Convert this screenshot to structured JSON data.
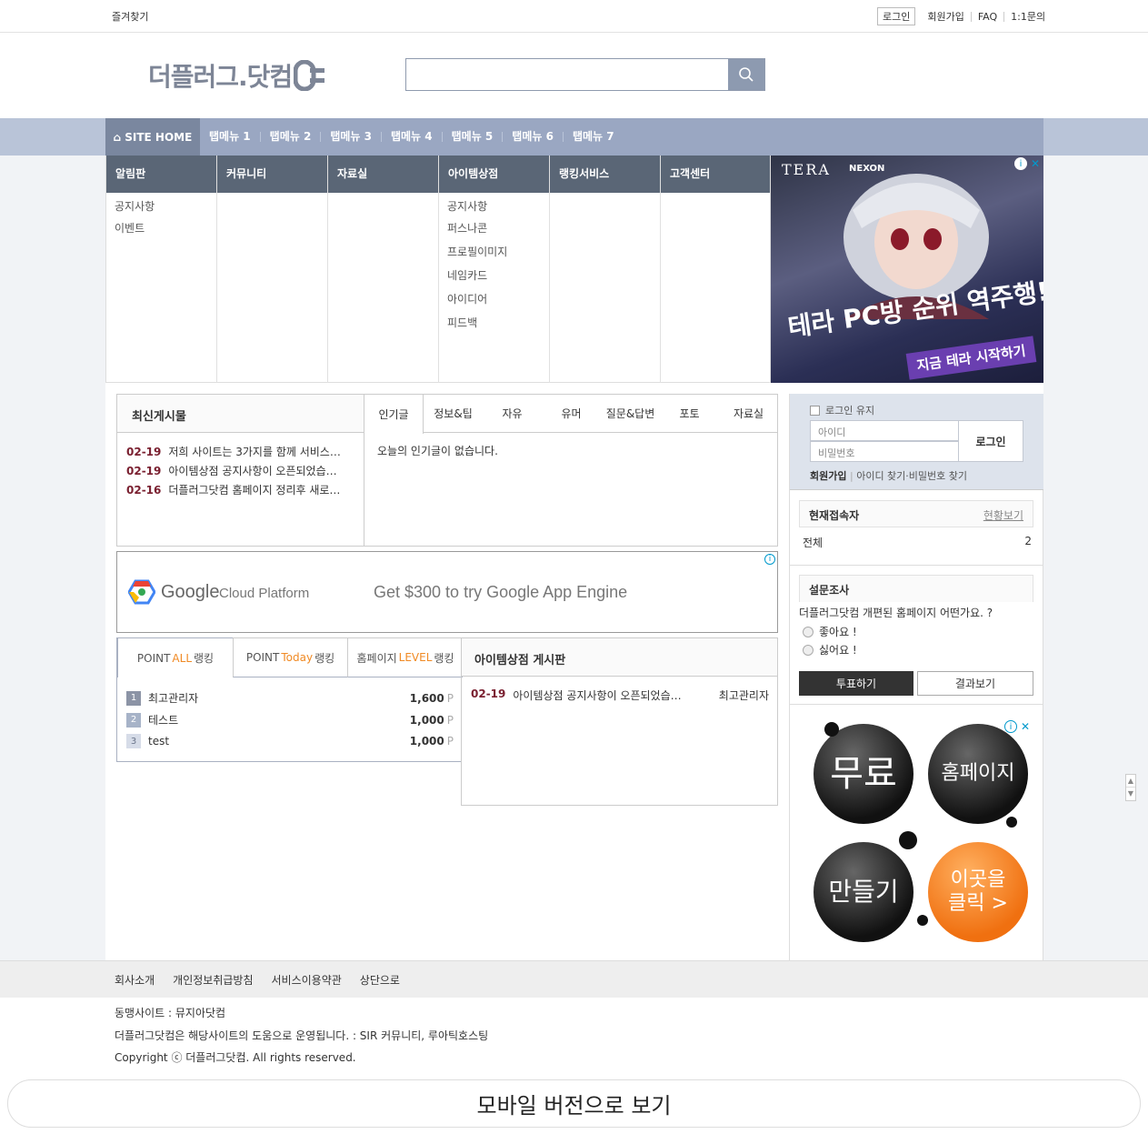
{
  "topbar": {
    "bookmark": "즐겨찾기",
    "login": "로그인",
    "links": [
      "회원가입",
      "FAQ",
      "1:1문의"
    ]
  },
  "header": {
    "logo_text": "더플러그.닷컴",
    "search_placeholder": ""
  },
  "nav": {
    "home": "SITE HOME",
    "tabs": [
      "탭메뉴 1",
      "탭메뉴 2",
      "탭메뉴 3",
      "탭메뉴 4",
      "탭메뉴 5",
      "탭메뉴 6",
      "탭메뉴 7"
    ]
  },
  "megamenu": [
    {
      "title": "알림판",
      "items": [
        "공지사항",
        "이벤트"
      ]
    },
    {
      "title": "커뮤니티",
      "items": []
    },
    {
      "title": "자료실",
      "items": []
    },
    {
      "title": "아이템상점",
      "items": [
        "공지사항",
        "퍼스나콘",
        "프로필이미지",
        "네임카드",
        "아이디어",
        "피드백"
      ]
    },
    {
      "title": "랭킹서비스",
      "items": []
    },
    {
      "title": "고객센터",
      "items": []
    }
  ],
  "ad1": {
    "brand1": "TERA",
    "brand2": "NEXON",
    "headline": "테라 PC방 순위 역주행!",
    "cta": "지금 테라 시작하기"
  },
  "latest": {
    "title": "최신게시물",
    "posts": [
      {
        "date": "02-19",
        "text": "저희 사이트는 3가지를 함께 서비스…"
      },
      {
        "date": "02-19",
        "text": "아이템상점 공지사항이 오픈되었습…"
      },
      {
        "date": "02-16",
        "text": "더플러그닷컴 홈페이지 정리후 새로…"
      }
    ],
    "tabs": [
      "인기글",
      "정보&팁",
      "자유",
      "유머",
      "질문&답변",
      "포토",
      "자료실"
    ],
    "empty": "오늘의 인기글이 없습니다."
  },
  "ad2": {
    "brand": "Google",
    "product": "Cloud Platform",
    "text": "Get $300 to try Google App Engine"
  },
  "ranking": {
    "tabs": [
      {
        "pre": "POINT ",
        "hl": "ALL",
        "post": " 랭킹"
      },
      {
        "pre": "POINT ",
        "hl": "Today",
        "post": " 랭킹"
      },
      {
        "pre": "홈페이지 ",
        "hl": "LEVEL",
        "post": " 랭킹"
      }
    ],
    "rows": [
      {
        "rank": "1",
        "name": "최고관리자",
        "points": "1,600",
        "unit": "P"
      },
      {
        "rank": "2",
        "name": "테스트",
        "points": "1,000",
        "unit": "P"
      },
      {
        "rank": "3",
        "name": "test",
        "points": "1,000",
        "unit": "P"
      }
    ]
  },
  "itemboard": {
    "title": "아이템상점 게시판",
    "posts": [
      {
        "date": "02-19",
        "text": "아이템상점 공지사항이 오픈되었습…",
        "author": "최고관리자"
      }
    ]
  },
  "login": {
    "keep": "로그인 유지",
    "id_placeholder": "아이디",
    "pw_placeholder": "비밀번호",
    "button": "로그인",
    "signup": "회원가입",
    "find": "아이디 찾기·비밀번호 찾기"
  },
  "connect": {
    "title": "현재접속자",
    "link": "현황보기",
    "label": "전체",
    "count": "2"
  },
  "poll": {
    "title": "설문조사",
    "question": "더플러그닷컴 개편된 홈페이지 어떤가요. ?",
    "options": [
      "좋아요 !",
      "싫어요 !"
    ],
    "vote": "투표하기",
    "result": "결과보기"
  },
  "ad3": {
    "balls": [
      "무료",
      "홈페이지",
      "만들기",
      "이곳을 클릭 >"
    ]
  },
  "footer": {
    "links": [
      "회사소개",
      "개인정보취급방침",
      "서비스이용약관",
      "상단으로"
    ],
    "sister": "동맹사이트 : 뮤지아닷컴",
    "operated": "더플러그닷컴은 해당사이트의 도움으로 운영됩니다. : SIR 커뮤니티, 루아틱호스팅",
    "copyright": "Copyright ⓒ 더플러그닷컴. All rights reserved."
  },
  "mobile": "모바일 버전으로 보기"
}
